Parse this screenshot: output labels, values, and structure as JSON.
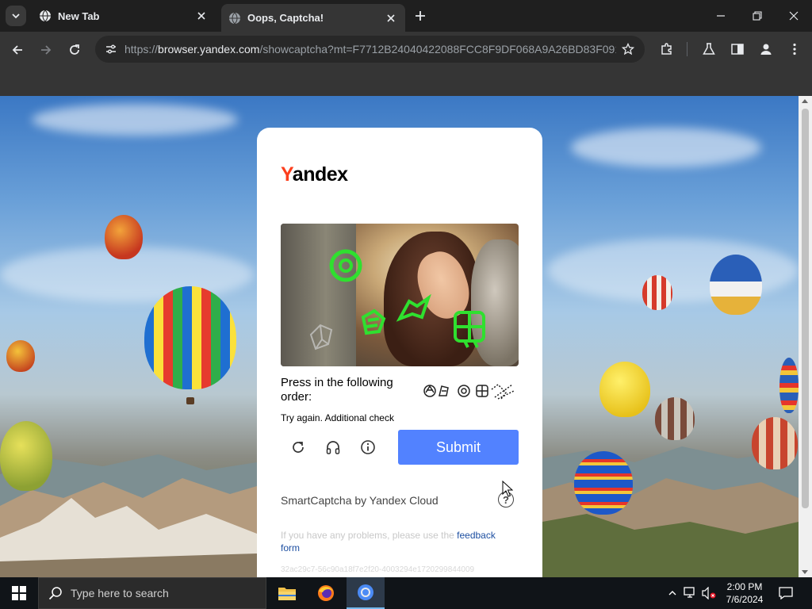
{
  "browser": {
    "tabs": [
      {
        "title": "New Tab",
        "active": false
      },
      {
        "title": "Oops, Captcha!",
        "active": true
      }
    ],
    "url_scheme": "https://",
    "url_host": "browser.yandex.com",
    "url_path": "/showcaptcha?mt=F7712B24040422088FCC8F9DF068A9A26BD83F091..."
  },
  "captcha": {
    "logo_first": "Y",
    "logo_rest": "andex",
    "instruction": "Press in the following order:",
    "retry_message": "Try again. Additional check",
    "submit_label": "Submit",
    "brand_line": "SmartCaptcha by Yandex Cloud",
    "help_label": "?",
    "problem_text": "If you have any problems, please use the ",
    "problem_link": "feedback form",
    "trace_id": "32ac29c7-56c90a18f7e2f20-4003294e1720299844009",
    "accent_color": "#5282ff",
    "brand_red": "#fc3f1d"
  },
  "taskbar": {
    "search_placeholder": "Type here to search",
    "time": "2:00 PM",
    "date": "7/6/2024"
  }
}
